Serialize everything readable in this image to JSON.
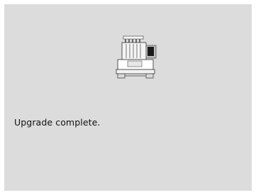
{
  "screen": {
    "background": "#dcdcdc",
    "icon": "embroidery-machine-icon",
    "message": "Upgrade complete."
  }
}
